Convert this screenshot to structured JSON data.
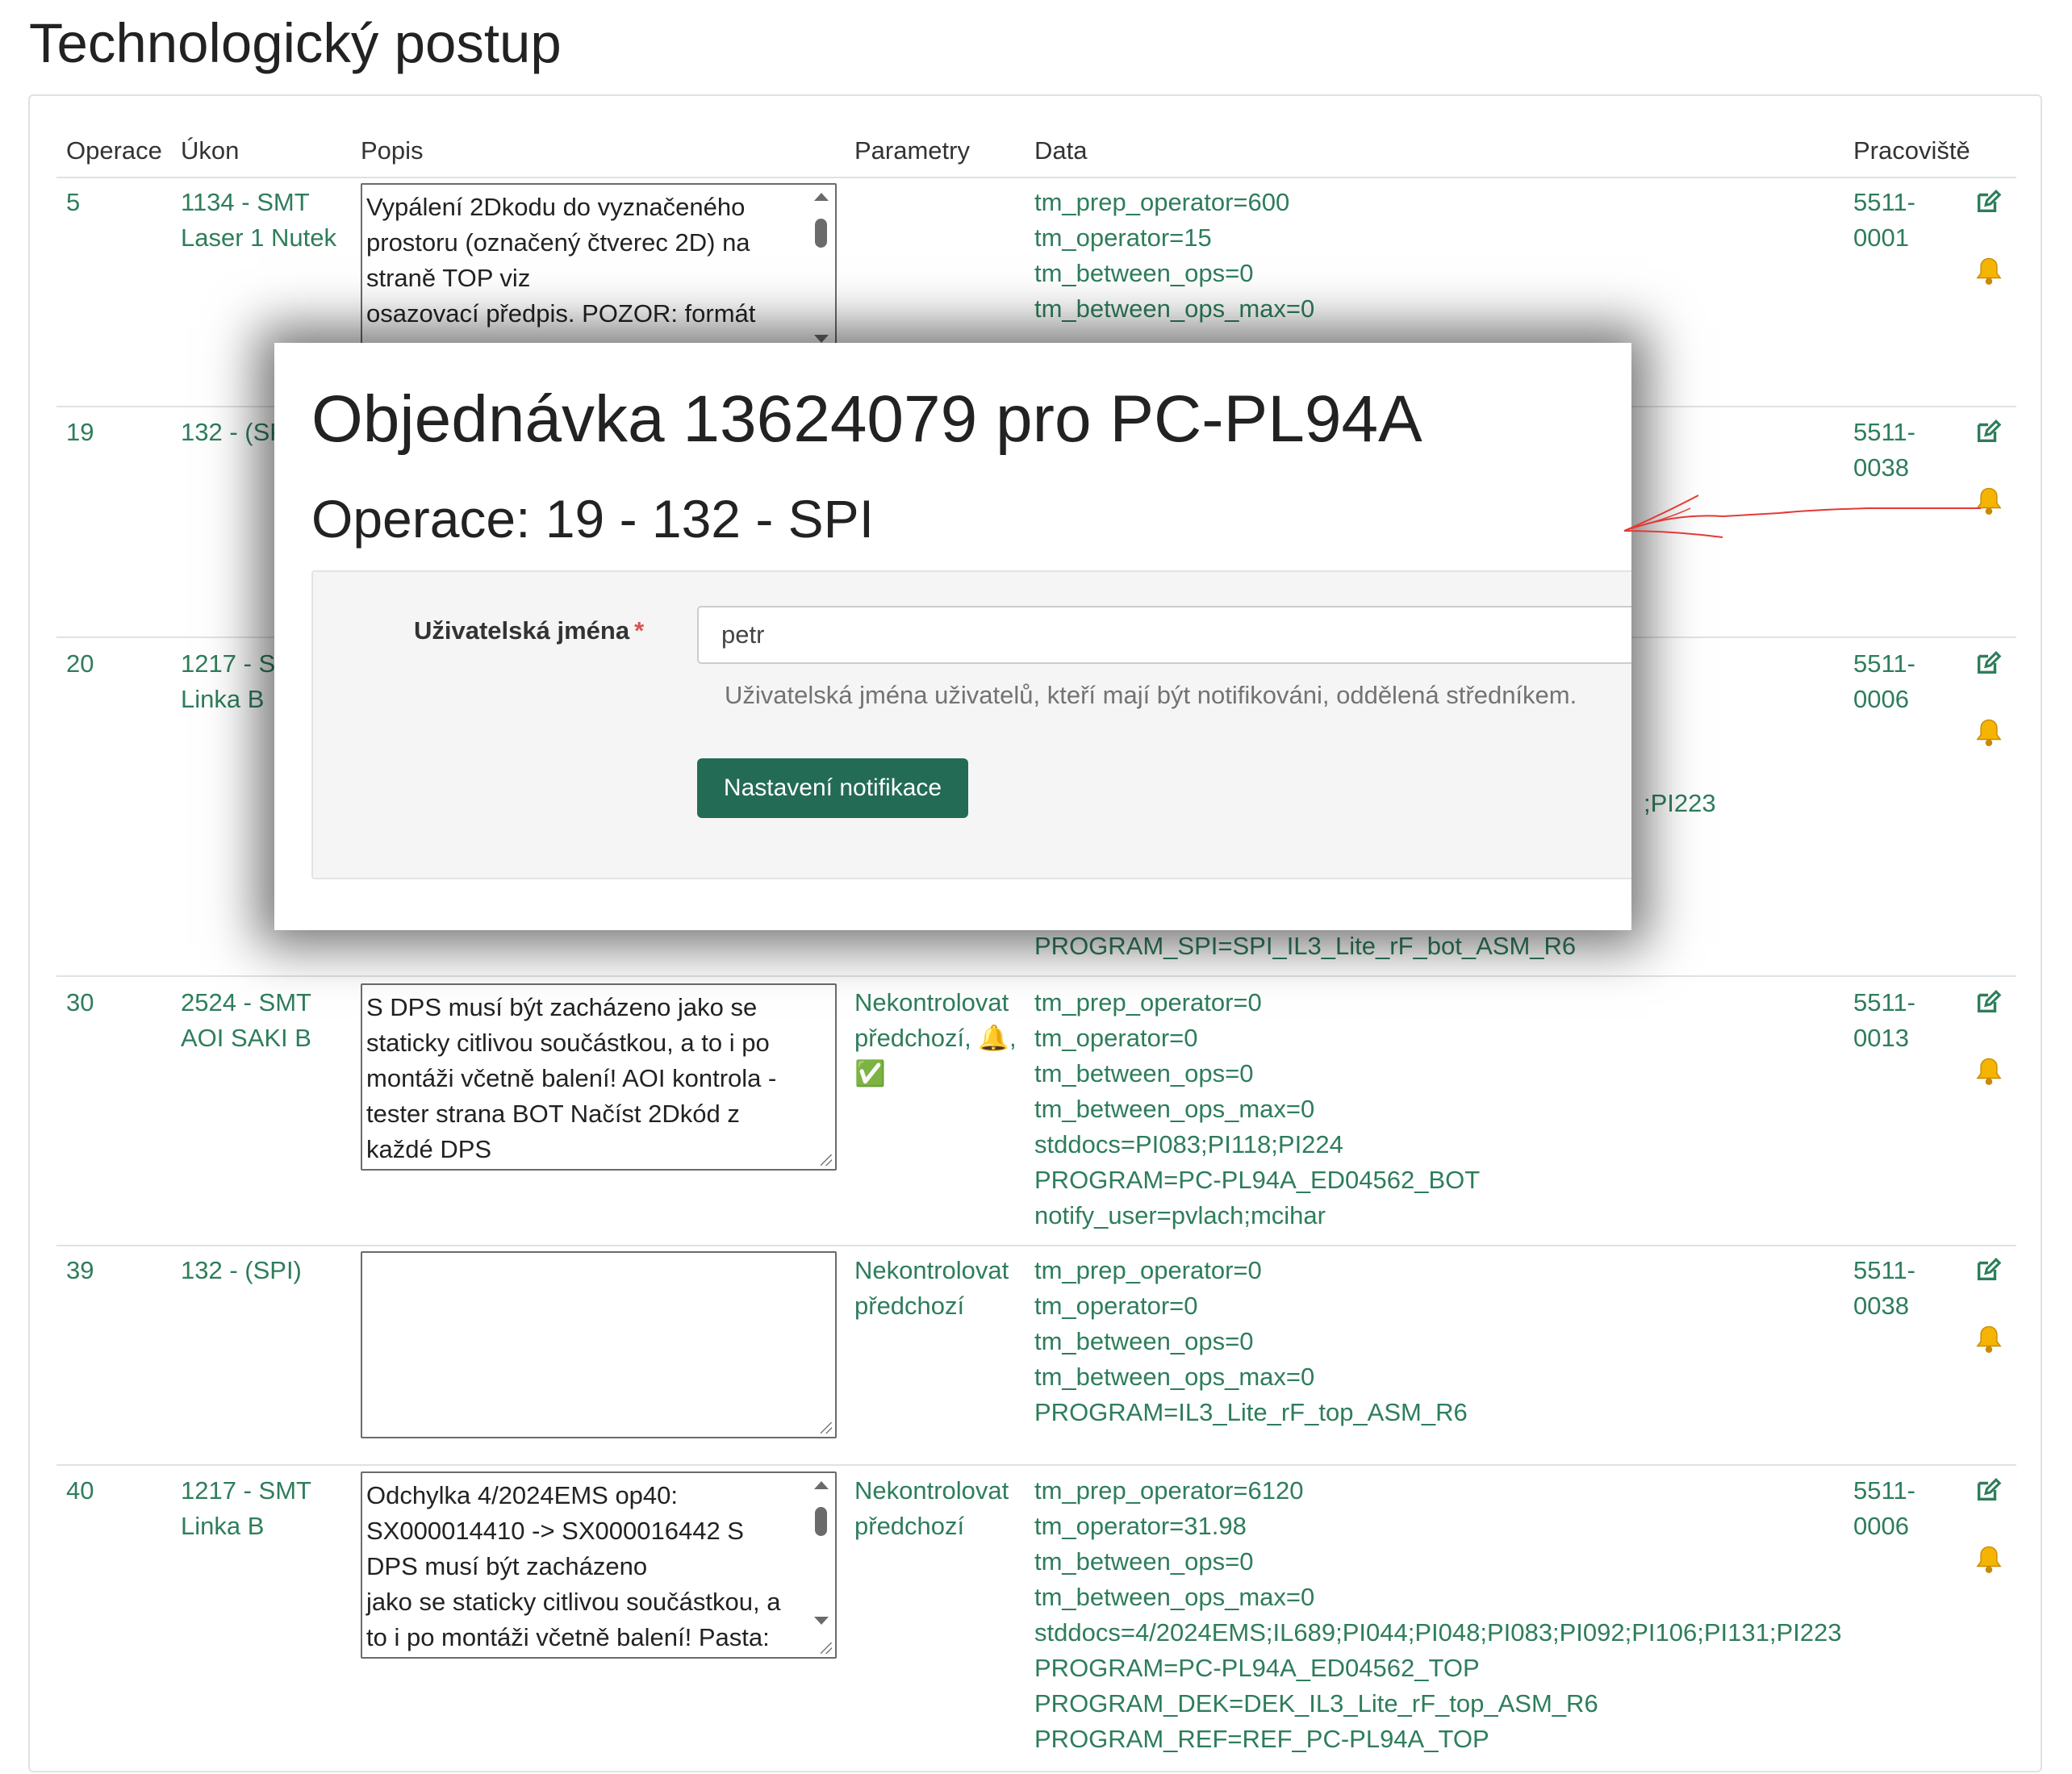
{
  "page": {
    "title": "Technologický postup"
  },
  "table": {
    "headers": [
      "Operace",
      "Úkon",
      "Popis",
      "Parametry",
      "Data",
      "Pracoviště"
    ],
    "rows": [
      {
        "op": "5",
        "ukon": [
          "1134 - SMT",
          "Laser 1 Nutek"
        ],
        "popis": "Vypálení 2Dkodu do vyznačeného prostoru (označený čtverec 2D) na straně TOP viz\nosazovací předpis. POZOR: formát",
        "parametry": [],
        "data": [
          "tm_prep_operator=600",
          "tm_operator=15",
          "tm_between_ops=0",
          "tm_between_ops_max=0"
        ],
        "pracoviste": [
          "5511-",
          "0001"
        ]
      },
      {
        "op": "19",
        "ukon": [
          "132 - (SP"
        ],
        "popis": "",
        "parametry": [],
        "data": [],
        "pracoviste": [
          "5511-",
          "0038"
        ]
      },
      {
        "op": "20",
        "ukon": [
          "1217 - S",
          "Linka B"
        ],
        "popis": "",
        "parametry": [],
        "data": [
          ";PI223",
          "PROGRAM_SPI=SPI_IL3_Lite_rF_bot_ASM_R6"
        ],
        "pracoviste": [
          "5511-",
          "0006"
        ]
      },
      {
        "op": "30",
        "ukon": [
          "2524 - SMT",
          "AOI SAKI B"
        ],
        "popis": "S DPS musí být zacházeno jako se staticky citlivou součástkou, a to i po montáži včetně balení! AOI kontrola - tester strana BOT Načíst 2Dkód z každé DPS",
        "parametry": [
          "Nekontrolovat",
          "předchozí, 🔔,",
          "✅"
        ],
        "data": [
          "tm_prep_operator=0",
          "tm_operator=0",
          "tm_between_ops=0",
          "tm_between_ops_max=0",
          "stddocs=PI083;PI118;PI224",
          "PROGRAM=PC-PL94A_ED04562_BOT",
          "notify_user=pvlach;mcihar"
        ],
        "pracoviste": [
          "5511-",
          "0013"
        ]
      },
      {
        "op": "39",
        "ukon": [
          "132 - (SPI)"
        ],
        "popis": "",
        "parametry": [
          "Nekontrolovat",
          "předchozí"
        ],
        "data": [
          "tm_prep_operator=0",
          "tm_operator=0",
          "tm_between_ops=0",
          "tm_between_ops_max=0",
          "PROGRAM=IL3_Lite_rF_top_ASM_R6"
        ],
        "pracoviste": [
          "5511-",
          "0038"
        ]
      },
      {
        "op": "40",
        "ukon": [
          "1217 - SMT",
          "Linka B"
        ],
        "popis": "Odchylka 4/2024EMS op40: SX000014410 -> SX000016442 S DPS musí být zacházeno\njako se staticky citlivou součástkou, a to i po montáži včetně balení! Pasta:",
        "parametry": [
          "Nekontrolovat",
          "předchozí"
        ],
        "data": [
          "tm_prep_operator=6120",
          "tm_operator=31.98",
          "tm_between_ops=0",
          "tm_between_ops_max=0",
          "stddocs=4/2024EMS;IL689;PI044;PI048;PI083;PI092;PI106;PI131;PI223",
          "PROGRAM=PC-PL94A_ED04562_TOP",
          "PROGRAM_DEK=DEK_IL3_Lite_rF_top_ASM_R6",
          "PROGRAM_REF=REF_PC-PL94A_TOP"
        ],
        "pracoviste": [
          "5511-",
          "0006"
        ]
      }
    ]
  },
  "modal": {
    "title": "Objednávka 13624079 pro PC-PL94A",
    "subtitle": "Operace: 19 - 132 - SPI",
    "field_label": "Uživatelská jména",
    "required_mark": "*",
    "input_value": "petr",
    "help_text": "Uživatelská jména uživatelů, kteří mají být notifikováni, oddělená středníkem.",
    "submit_label": "Nastavení notifikace"
  },
  "icons": {
    "edit": "edit-icon",
    "bell": "bell-icon"
  },
  "colors": {
    "accent": "#2e7d5b",
    "button": "#236b55",
    "bell": "#f5b400",
    "annotation": "#e53935"
  }
}
